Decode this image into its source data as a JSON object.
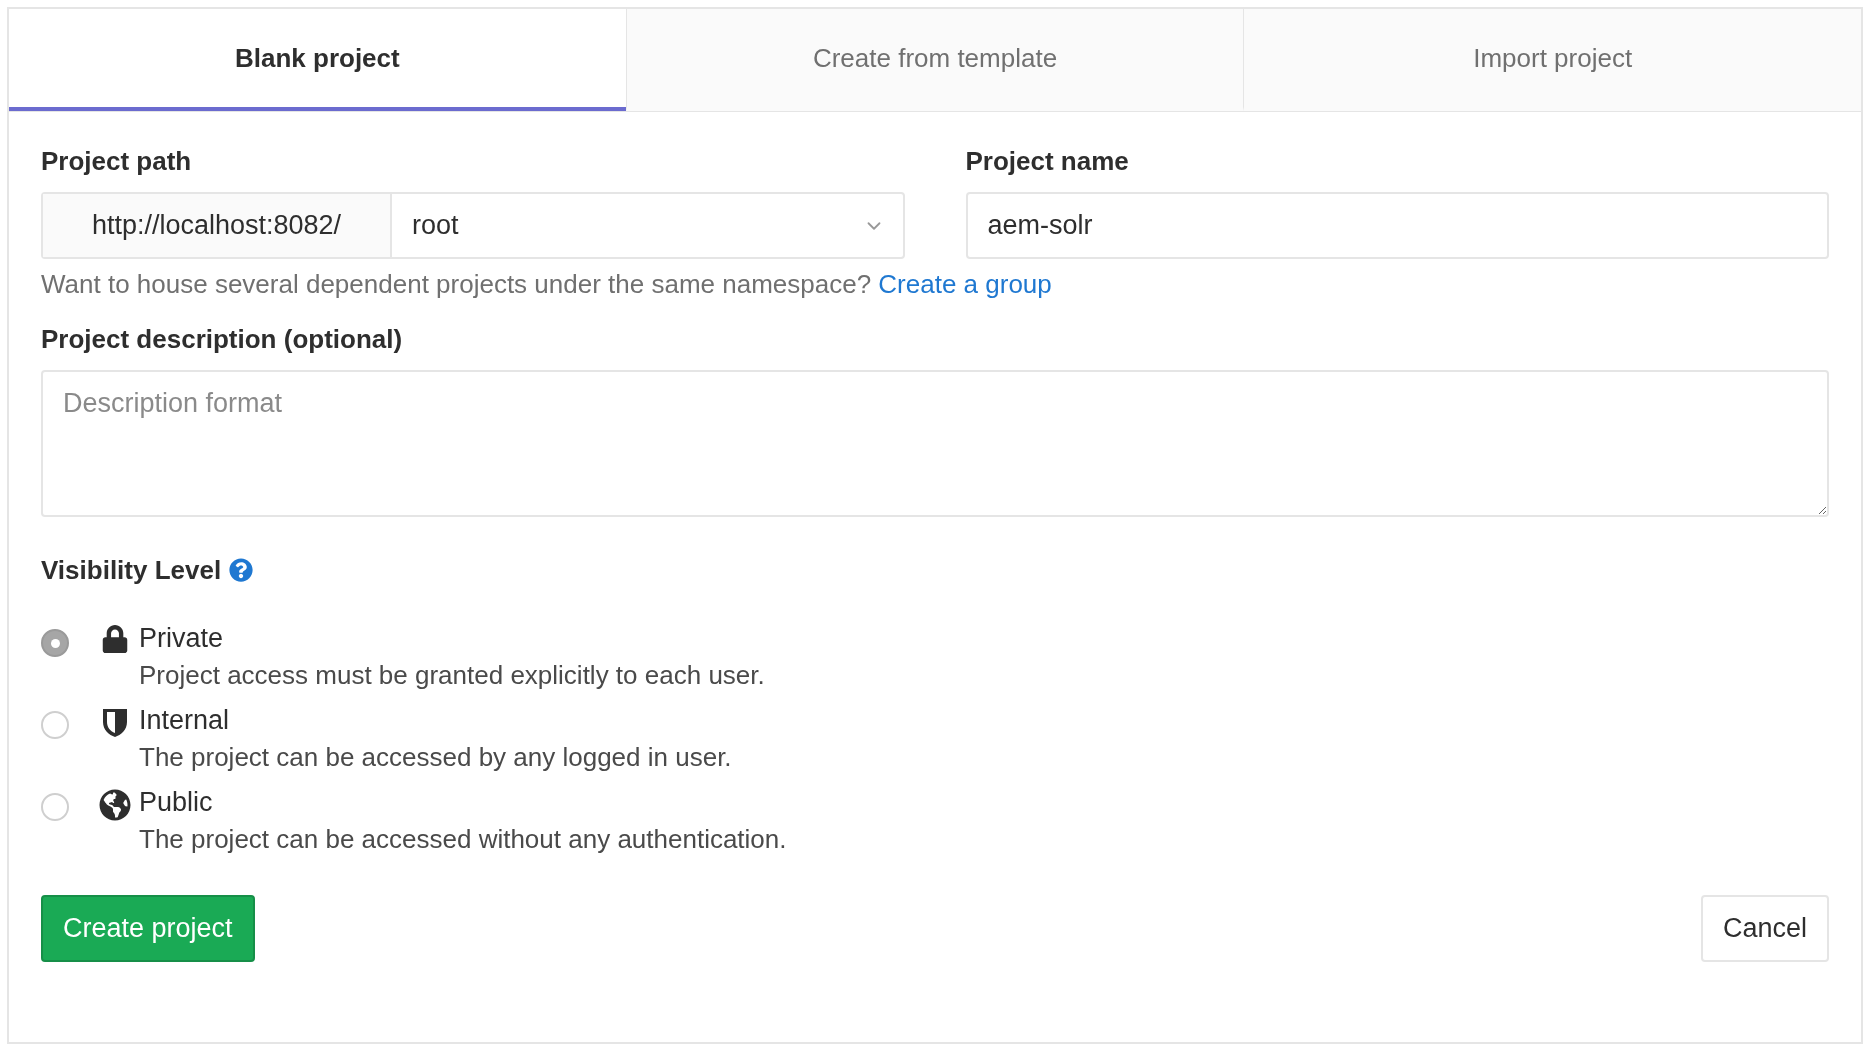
{
  "tabs": [
    {
      "label": "Blank project",
      "selected": true
    },
    {
      "label": "Create from template",
      "selected": false
    },
    {
      "label": "Import project",
      "selected": false
    }
  ],
  "project_path": {
    "label": "Project path",
    "prefix": "http://localhost:8082/",
    "namespace": "root"
  },
  "project_name": {
    "label": "Project name",
    "value": "aem-solr"
  },
  "help_text": {
    "text": "Want to house several dependent projects under the same namespace?",
    "link": "Create a group"
  },
  "description": {
    "label": "Project description (optional)",
    "placeholder": "Description format"
  },
  "visibility": {
    "label": "Visibility Level",
    "options": [
      {
        "kind": "lock",
        "label": "Private",
        "description": "Project access must be granted explicitly to each user.",
        "selected": true
      },
      {
        "kind": "shield",
        "label": "Internal",
        "description": "The project can be accessed by any logged in user.",
        "selected": false
      },
      {
        "kind": "globe",
        "label": "Public",
        "description": "The project can be accessed without any authentication.",
        "selected": false
      }
    ]
  },
  "buttons": {
    "create": "Create project",
    "cancel": "Cancel"
  }
}
